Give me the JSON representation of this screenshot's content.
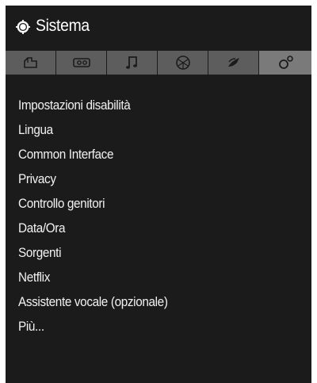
{
  "header": {
    "title": "Sistema",
    "icon": "gear-icon"
  },
  "tabs": [
    {
      "icon": "picture-icon",
      "active": false
    },
    {
      "icon": "sound-icon",
      "active": false
    },
    {
      "icon": "music-note-icon",
      "active": false
    },
    {
      "icon": "network-globe-icon",
      "active": false
    },
    {
      "icon": "installation-satellite-icon",
      "active": false
    },
    {
      "icon": "system-settings-icon",
      "active": true
    }
  ],
  "menu": {
    "items": [
      "Impostazioni disabilità",
      "Lingua",
      "Common Interface",
      "Privacy",
      "Controllo genitori",
      "Data/Ora",
      "Sorgenti",
      "Netflix",
      "Assistente vocale (opzionale)",
      "Più..."
    ]
  },
  "colors": {
    "background": "#1b1b1b",
    "tab": "#5d5d5d",
    "tab_active": "#7a7a7a",
    "text": "#f2f2f2"
  }
}
